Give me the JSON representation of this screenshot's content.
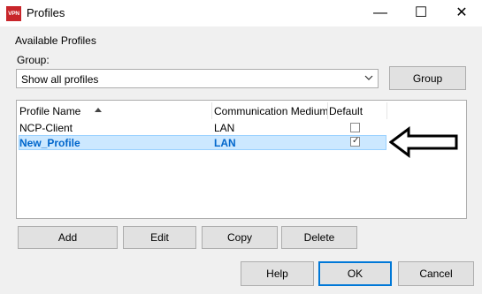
{
  "window": {
    "icon_text": "VPN",
    "title": "Profiles",
    "minimize_glyph": "—",
    "maximize_glyph": "☐",
    "close_glyph": "✕"
  },
  "groupbox": {
    "title": "Available Profiles"
  },
  "group_filter": {
    "label": "Group:",
    "selected_value": "Show all profiles",
    "button_label": "Group"
  },
  "profile_list": {
    "columns": [
      {
        "label": "Profile Name",
        "sorted": "ascending"
      },
      {
        "label": "Communication Medium"
      },
      {
        "label": "Default"
      }
    ],
    "rows": [
      {
        "name": "NCP-Client",
        "medium": "LAN",
        "default": false,
        "selected": false
      },
      {
        "name": "New_Profile",
        "medium": "LAN",
        "default": true,
        "selected": true
      }
    ]
  },
  "list_actions": {
    "add": "Add",
    "edit": "Edit",
    "copy": "Copy",
    "delete": "Delete"
  },
  "dialog_buttons": {
    "help": "Help",
    "ok": "OK",
    "cancel": "Cancel"
  },
  "annotation": {
    "icon": "left-arrow-icon",
    "points_to": "New_Profile"
  },
  "colors": {
    "selection_background": "#cce8ff",
    "selection_text": "#0066cc",
    "app_icon": "#c8262b",
    "focus_border": "#0078d7"
  }
}
